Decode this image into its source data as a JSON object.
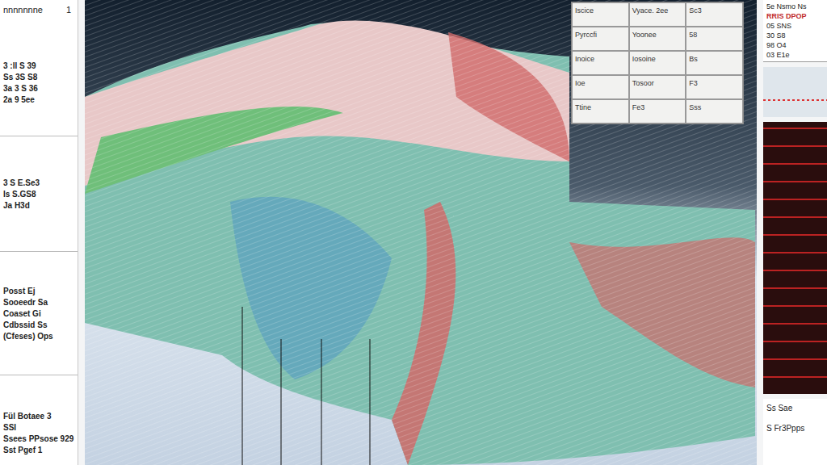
{
  "left_panel": {
    "title": "nnnnnnne",
    "badge": "1",
    "groups": [
      [
        "3 :ll S 39",
        "Ss 3S S8",
        "3a 3 S 36",
        "2a 9 5ee"
      ],
      [
        "3 S E.Se3",
        "Is S.GS8",
        "Ja H3d"
      ],
      [
        "Posst Ej",
        "Sooeedr Sa",
        "Coaset Gi",
        "Cdbssid Ss",
        "(Cfeses) Ops"
      ],
      [
        "Fül Botaee 3",
        "SSI",
        "Ssees PPsose 929",
        "Sst Pgef 1"
      ]
    ]
  },
  "table": {
    "rows": [
      [
        "Iscice",
        "Vyace. 2ee",
        "Sc3"
      ],
      [
        "Pyrccfi",
        "Yoonee",
        "58"
      ],
      [
        "Inoice",
        "Iosoine",
        "Bs"
      ],
      [
        "Ioe",
        "Tosoor",
        "F3"
      ],
      [
        "Ttine",
        "Fe3",
        "Sss"
      ]
    ]
  },
  "right_panel": {
    "header": "5e Nsmo Ns",
    "alert": "RRIS DPOP",
    "rows": [
      "05 SNS",
      "30 S8",
      "98 O4",
      "03 E1e"
    ],
    "footer": [
      "Ss Sae",
      "S Fr3Ppps"
    ]
  }
}
